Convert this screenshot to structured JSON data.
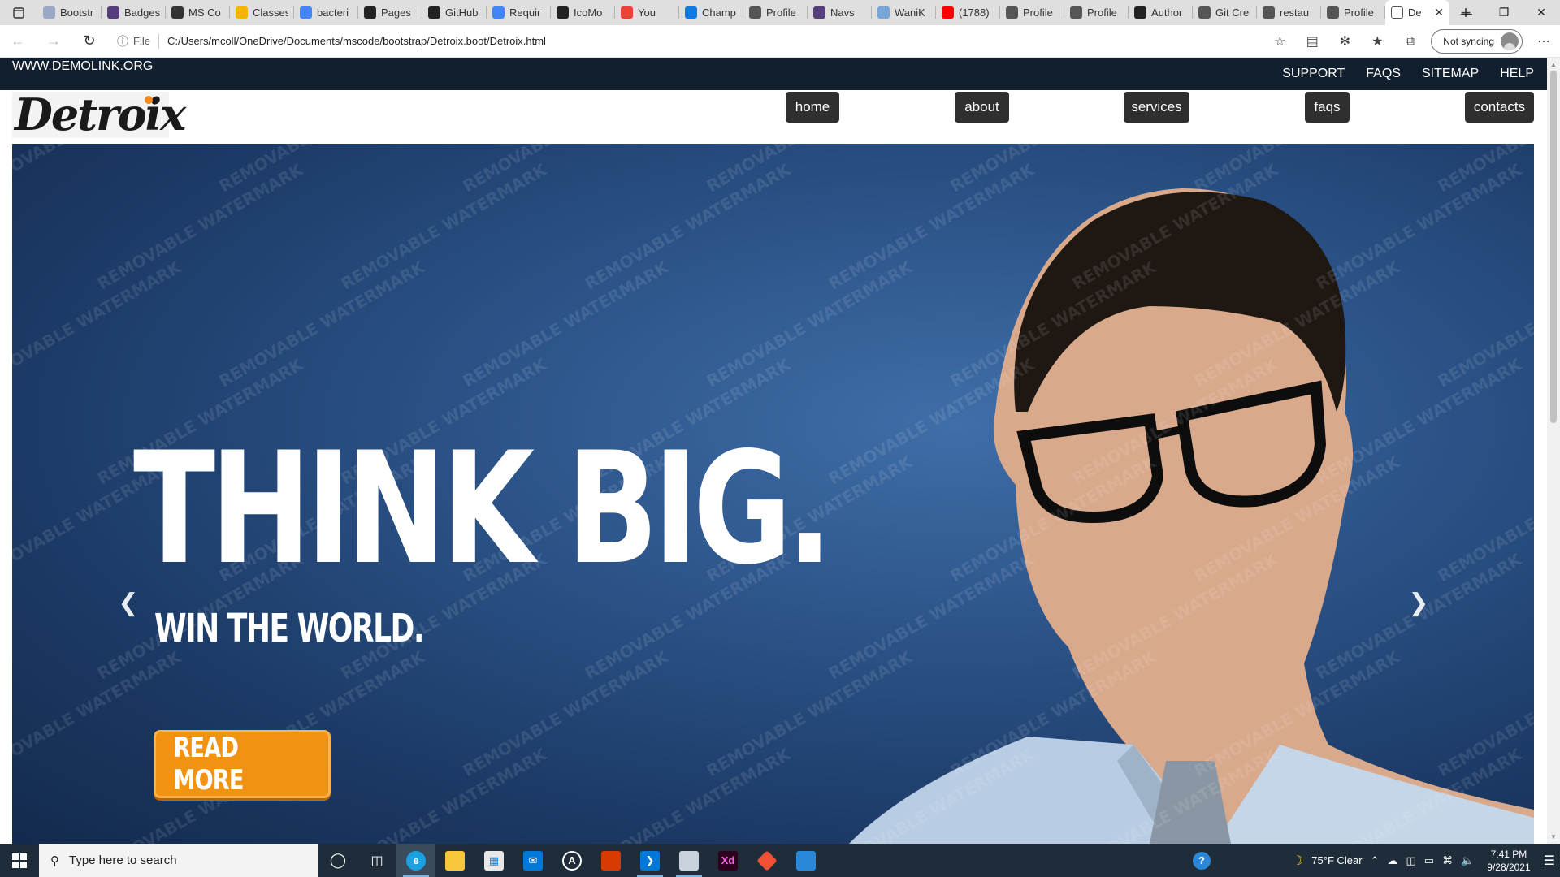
{
  "browser": {
    "tabs": [
      {
        "title": "Bootstr",
        "icon": "web-icon",
        "color": "#9aa7c7"
      },
      {
        "title": "Badges",
        "icon": "bootstrap-icon",
        "color": "#563d7c"
      },
      {
        "title": "MS Co",
        "icon": "classroom-icon",
        "color": "#333333"
      },
      {
        "title": "Classes",
        "icon": "classes-icon",
        "color": "#f4b400"
      },
      {
        "title": "bacteri",
        "icon": "google-icon",
        "color": "#4285f4"
      },
      {
        "title": "Pages",
        "icon": "github-icon",
        "color": "#222222"
      },
      {
        "title": "GitHub",
        "icon": "github-icon",
        "color": "#222222"
      },
      {
        "title": "Requir",
        "icon": "docs-icon",
        "color": "#4285f4"
      },
      {
        "title": "IcoMo",
        "icon": "icomoon-icon",
        "color": "#222222"
      },
      {
        "title": "You",
        "icon": "gmail-icon",
        "color": "#ea4335"
      },
      {
        "title": "Champ",
        "icon": "bing-icon",
        "color": "#0f7ae5"
      },
      {
        "title": "Profile",
        "icon": "file-icon",
        "color": "#555555"
      },
      {
        "title": "Navs",
        "icon": "bootstrap-icon",
        "color": "#563d7c"
      },
      {
        "title": "WaniK",
        "icon": "wanikani-icon",
        "color": "#7aa6d6"
      },
      {
        "title": "(1788)",
        "icon": "youtube-icon",
        "color": "#ff0000"
      },
      {
        "title": "Profile",
        "icon": "file-icon",
        "color": "#555555"
      },
      {
        "title": "Profile",
        "icon": "file-icon",
        "color": "#555555"
      },
      {
        "title": "Author",
        "icon": "github-icon",
        "color": "#222222"
      },
      {
        "title": "Git Cre",
        "icon": "file-icon",
        "color": "#555555"
      },
      {
        "title": "restau",
        "icon": "file-icon",
        "color": "#555555"
      },
      {
        "title": "Profile",
        "icon": "file-icon",
        "color": "#555555"
      }
    ],
    "active_tab": {
      "title": "De",
      "icon": "file-icon"
    },
    "address": {
      "scheme_label": "File",
      "url": "C:/Users/mcoll/OneDrive/Documents/mscode/bootstrap/Detroix.boot/Detroix.html"
    },
    "sync_label": "Not syncing"
  },
  "site": {
    "topbar": {
      "site_url": "WWW.DEMOLINK.ORG",
      "links": [
        "SUPPORT",
        "FAQS",
        "SITEMAP",
        "HELP"
      ]
    },
    "logo_text": "Detroix",
    "nav": [
      "home",
      "about",
      "services",
      "faqs",
      "contacts"
    ],
    "hero": {
      "headline": "THINK BIG.",
      "subline": "WIN THE WORLD.",
      "button": "READ MORE",
      "watermark": "REMOVABLE WATERMARK"
    }
  },
  "taskbar": {
    "search_placeholder": "Type here to search",
    "weather": "75°F  Clear",
    "time": "7:41 PM",
    "date": "9/28/2021"
  },
  "colors": {
    "topbar_bg": "#111f2e",
    "nav_pill_bg": "#2f2f2f",
    "accent_orange": "#f29213",
    "hero_blue": "#2c5489"
  }
}
